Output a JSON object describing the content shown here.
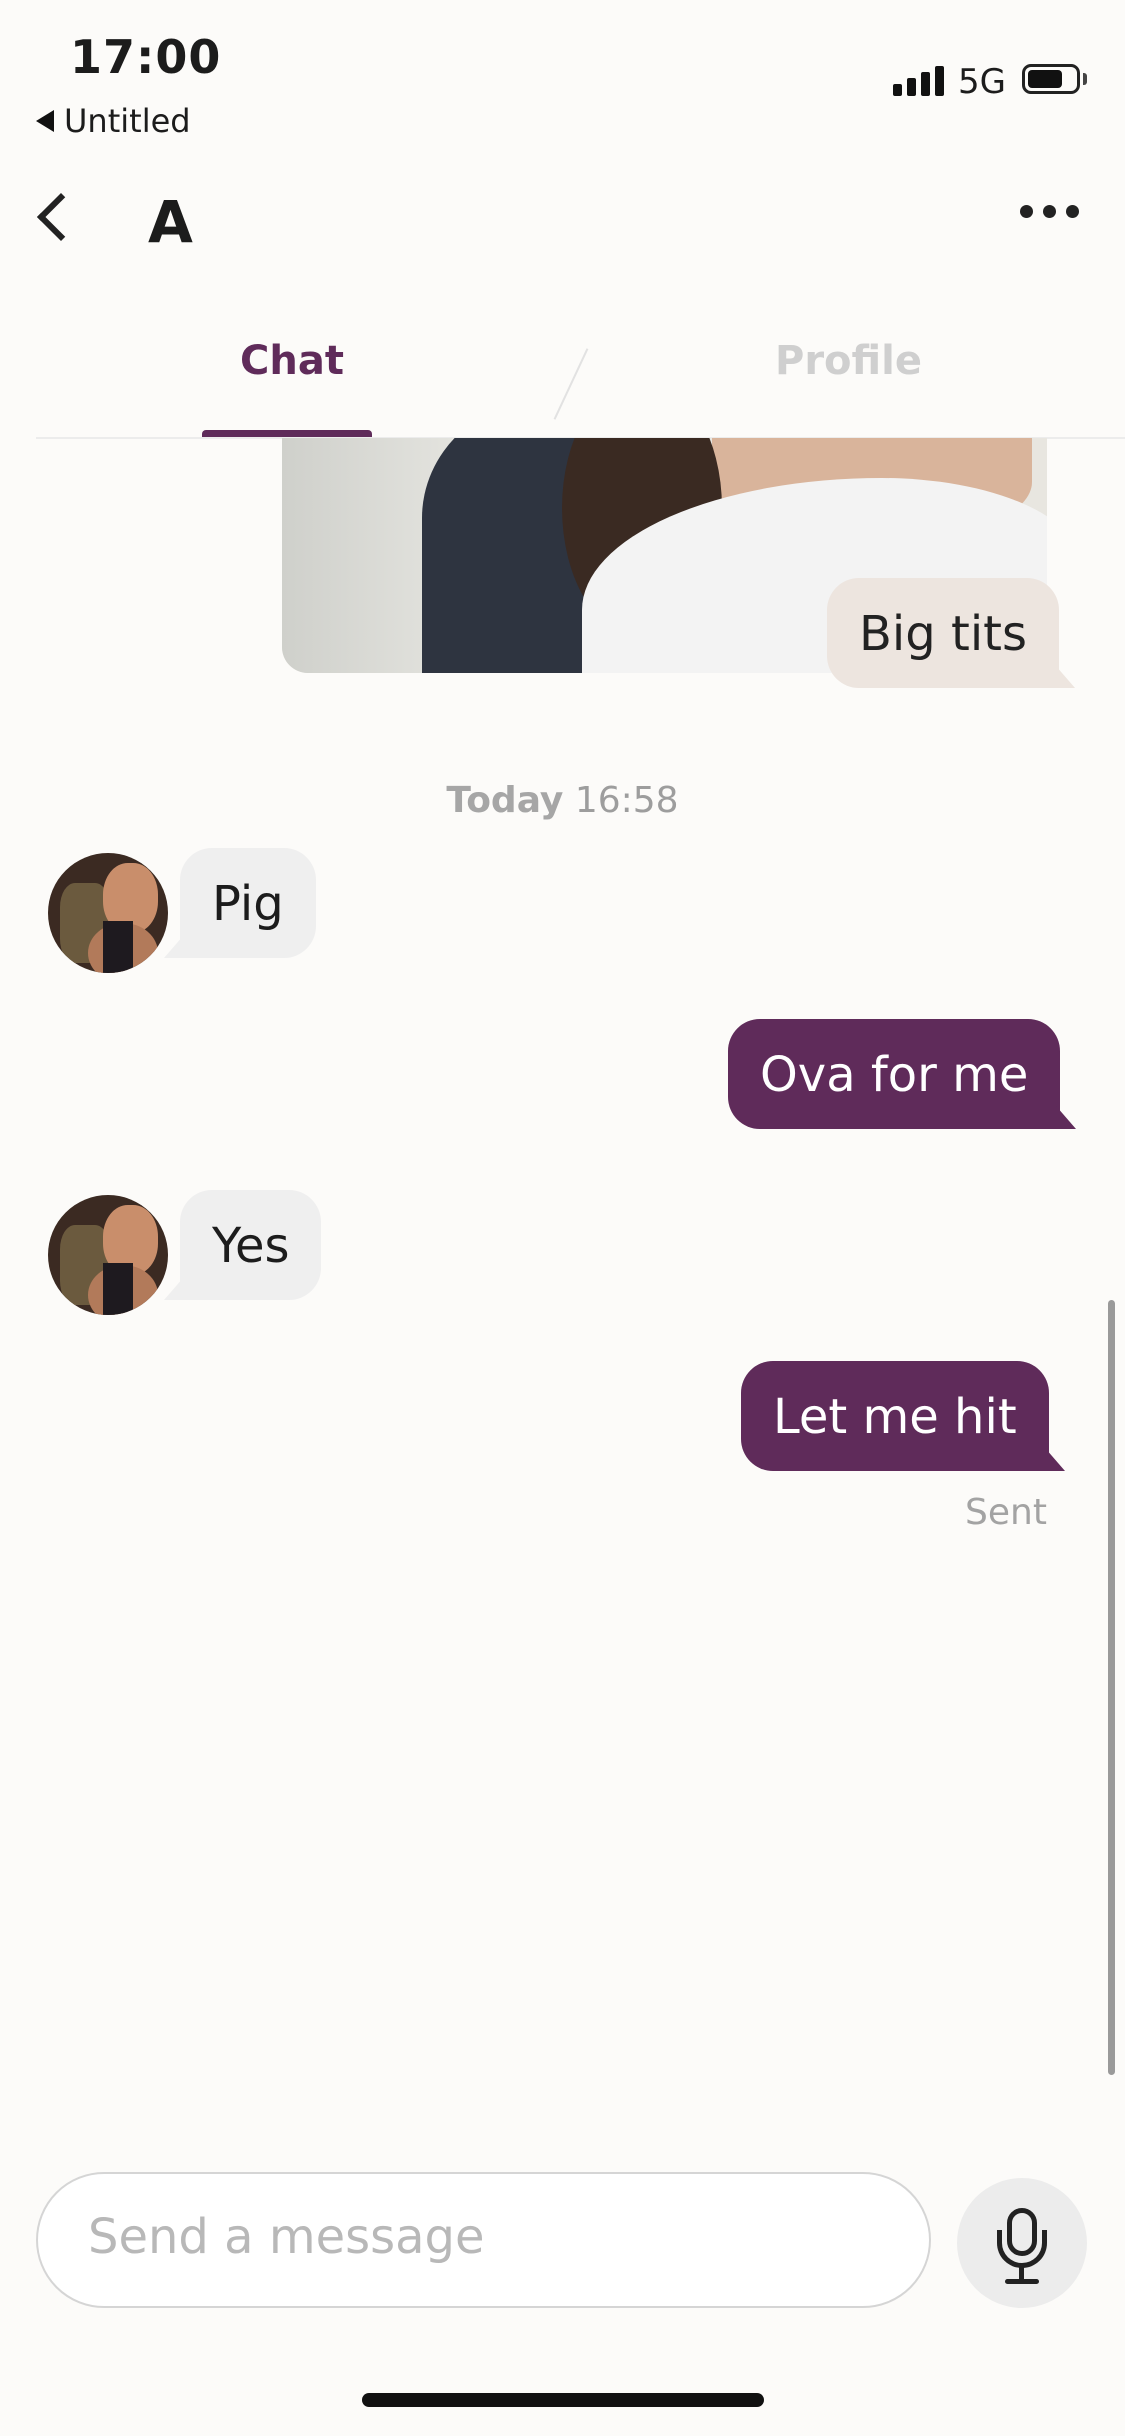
{
  "status_bar": {
    "time": "17:00",
    "back_app": "Untitled",
    "network": "5G"
  },
  "header": {
    "contact_name": "A"
  },
  "tabs": [
    {
      "label": "Chat",
      "active": true
    },
    {
      "label": "Profile",
      "active": false
    }
  ],
  "messages": {
    "photo_caption": "Big tits",
    "date_day": "Today",
    "date_time": "16:58",
    "in_1": "Pig",
    "out_1": "Ova for me",
    "in_2": "Yes",
    "out_2": "Let me hit",
    "out_2_status": "Sent"
  },
  "composer": {
    "placeholder": "Send a message"
  },
  "colors": {
    "accent": "#5f2b5a",
    "incoming_bubble": "#efefef",
    "caption_bubble": "#ede5df",
    "background": "#fcfbf9"
  },
  "icons": [
    "back-triangle-icon",
    "signal-icon",
    "battery-icon",
    "back-chevron-icon",
    "more-icon",
    "microphone-icon"
  ]
}
